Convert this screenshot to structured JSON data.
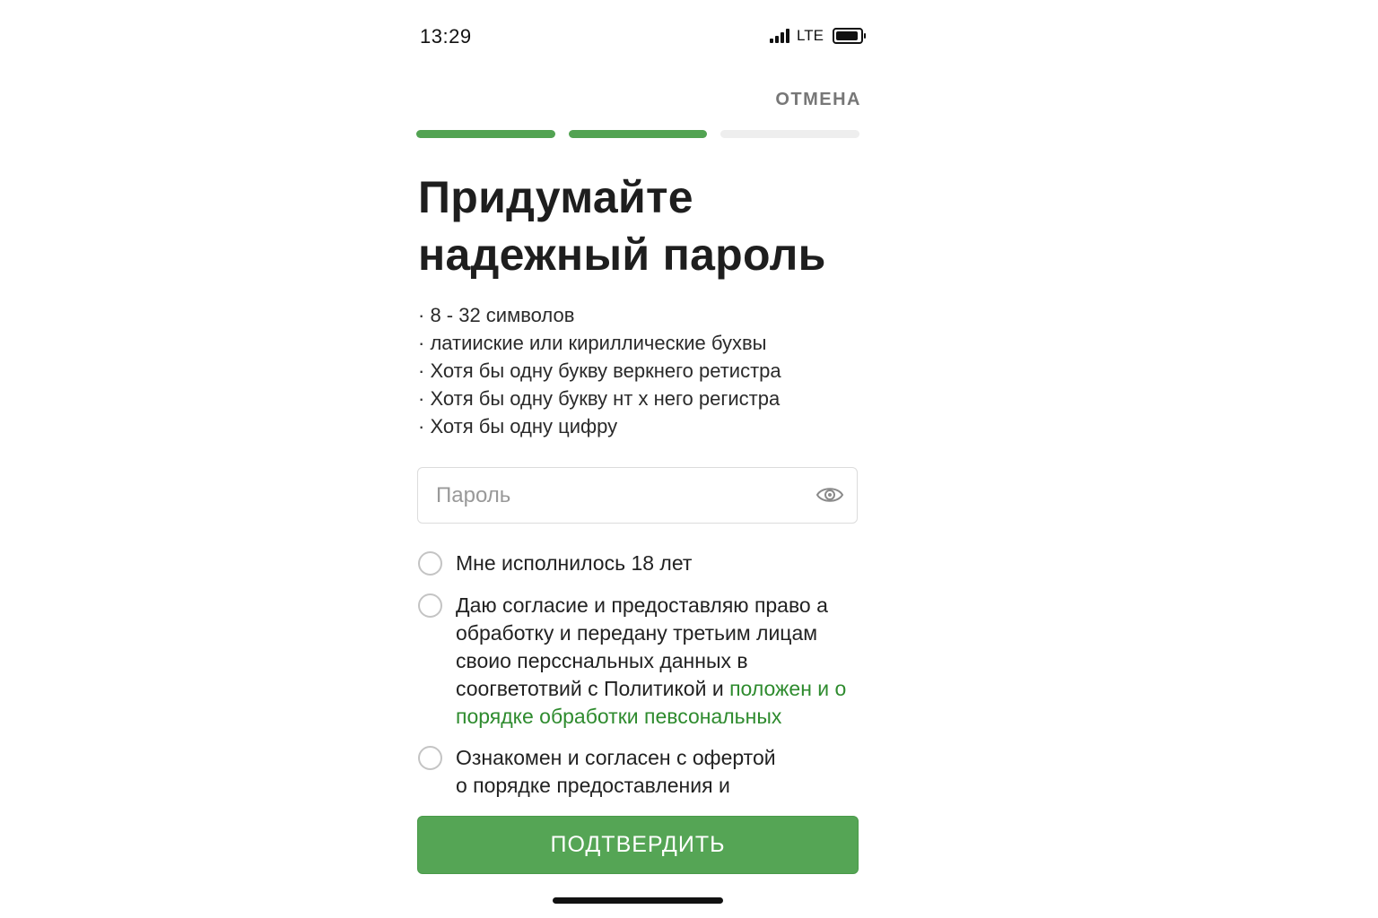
{
  "status_bar": {
    "time": "13:29",
    "network": "LTE",
    "icons": [
      "signal-icon",
      "battery-icon"
    ]
  },
  "header": {
    "cancel_label": "ОТМЕНА"
  },
  "progress": {
    "total_steps": 3,
    "completed_steps": 2
  },
  "title": {
    "line1": "Придумайте",
    "line2": "надежный пароль"
  },
  "requirements": [
    "· 8 - 32 символов",
    "· латиискиe или кириллические бухвы",
    "· Хотя бы одну букву веркнего ретистра",
    "· Хотя бы одну букву нт х него регистра",
    "· Хотя бы одну цифру"
  ],
  "password_field": {
    "value": "",
    "placeholder": "Пароль",
    "toggle_icon": "eye-icon"
  },
  "consents": {
    "age": {
      "text": "Мне исполнилось 18 лет",
      "checked": false
    },
    "personal_data": {
      "text": "Даю согласие и предоставляю право а обработку и передану третьим лицам своио персcнальных данных в соoгветотвий с Политикой и",
      "link_text": "положен и о порядке обработки певсональных",
      "checked": false
    },
    "offer": {
      "line1": "Ознакомен и согласен с офертой",
      "line2": "о порядке предоставления и",
      "checked": false
    }
  },
  "confirm_button": {
    "label": "ПОДТВЕРДИТЬ"
  },
  "colors": {
    "accent": "#52a352",
    "link": "#2e8b2e",
    "muted": "#777777"
  }
}
